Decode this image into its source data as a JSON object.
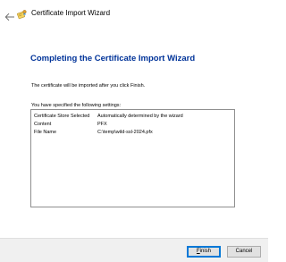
{
  "window": {
    "title": "Certificate Import Wizard",
    "back_icon": "back-arrow-icon",
    "title_icon": "certificate-wizard-icon"
  },
  "page": {
    "heading": "Completing the Certificate Import Wizard",
    "intro": "The certificate will be imported after you click Finish.",
    "settings_label": "You have specified the following settings:"
  },
  "settings": [
    {
      "key": "Certificate Store Selected",
      "value": "Automatically determined by the wizard"
    },
    {
      "key": "Content",
      "value": "PFX"
    },
    {
      "key": "File Name",
      "value": "C:\\temp\\wild-ssl-2024.pfx"
    }
  ],
  "buttons": {
    "finish": "Finish",
    "cancel": "Cancel"
  },
  "colors": {
    "heading": "#003399",
    "footer_bg": "#f0f0f0",
    "default_button_border": "#0078d7"
  }
}
